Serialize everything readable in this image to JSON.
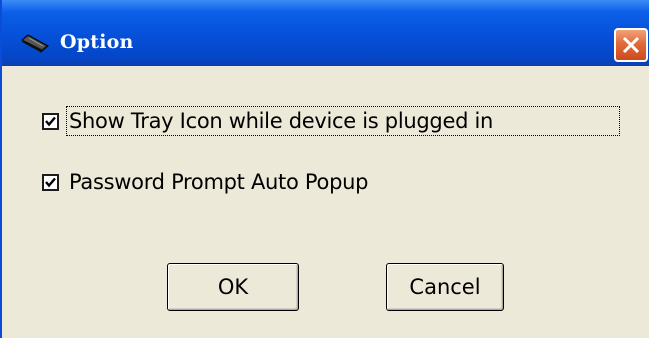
{
  "window": {
    "title": "Option"
  },
  "checkboxes": [
    {
      "label": "Show Tray Icon while device is plugged in",
      "checked": true
    },
    {
      "label": "Password Prompt Auto Popup",
      "checked": true
    }
  ],
  "buttons": {
    "ok_label": "OK",
    "cancel_label": "Cancel"
  },
  "icons": {
    "title": "device-icon",
    "close": "close-icon",
    "check": "check-icon"
  },
  "colors": {
    "titlebar": "#0650d8",
    "face": "#ece9d8",
    "close": "#e26a3a"
  }
}
